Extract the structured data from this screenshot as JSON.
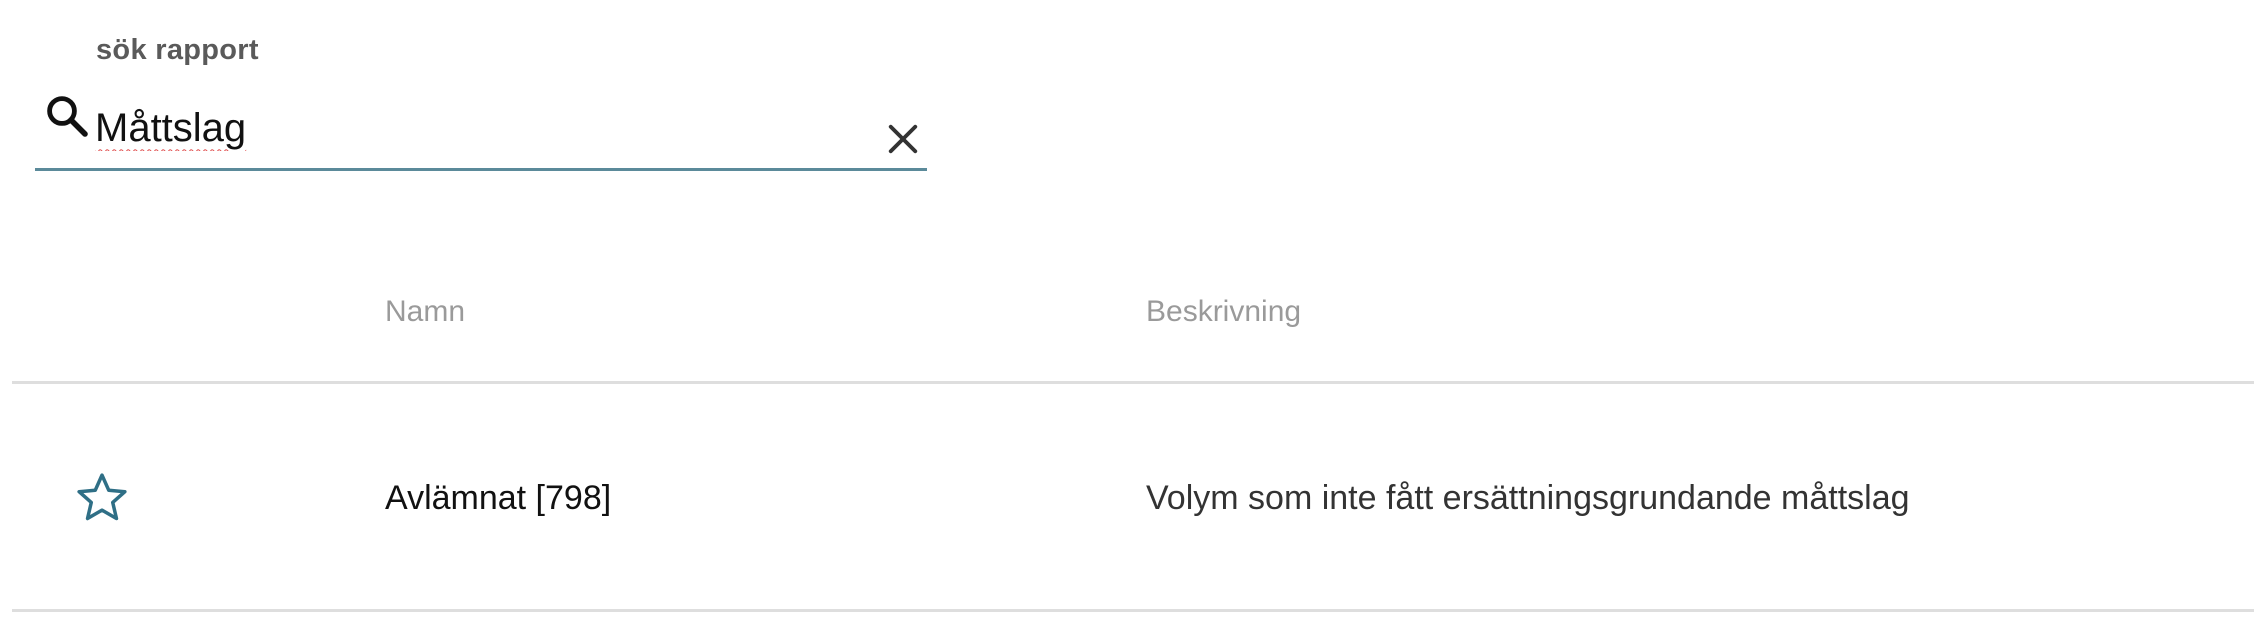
{
  "search": {
    "label": "sök rapport",
    "value": "Måttslag",
    "icon": "search-icon",
    "clear_icon": "close-icon",
    "accent_color": "#5b8a9a"
  },
  "table": {
    "columns": [
      "",
      "Namn",
      "Beskrivning"
    ],
    "rows": [
      {
        "favorite_icon": "star-outline-icon",
        "name": "Avlämnat [798]",
        "description": "Volym som inte fått ersättningsgrundande måttslag"
      }
    ]
  }
}
